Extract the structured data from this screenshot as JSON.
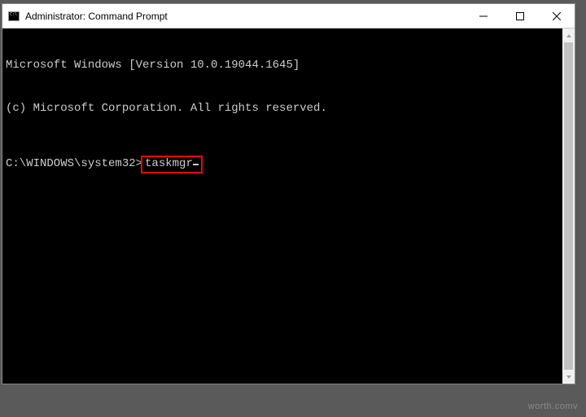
{
  "titlebar": {
    "title": "Administrator: Command Prompt"
  },
  "terminal": {
    "line1": "Microsoft Windows [Version 10.0.19044.1645]",
    "line2": "(c) Microsoft Corporation. All rights reserved.",
    "prompt": "C:\\WINDOWS\\system32>",
    "command": "taskmgr"
  },
  "watermark": "worth.comv"
}
